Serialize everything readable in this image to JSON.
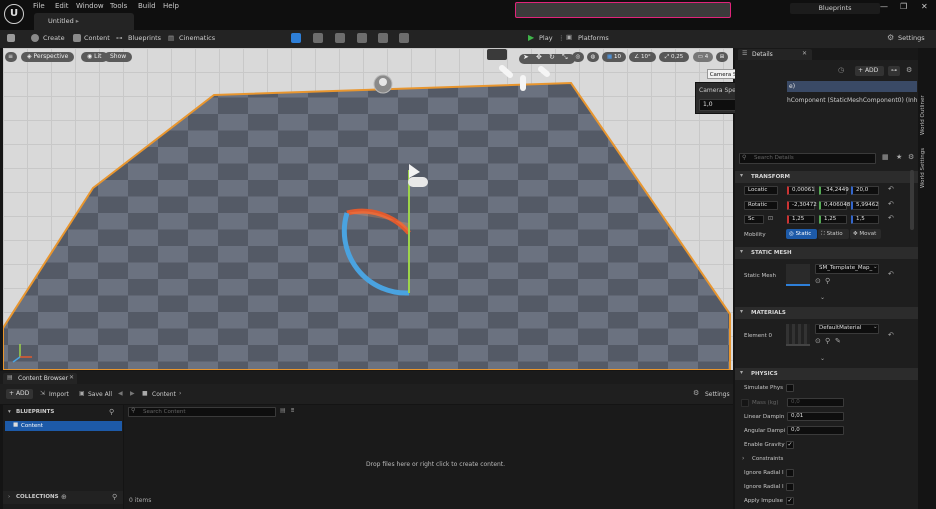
{
  "menu": [
    "File",
    "Edit",
    "Window",
    "Tools",
    "Build",
    "Help"
  ],
  "document_tab": "Untitled",
  "project_name": "Blueprints",
  "window_controls": {
    "minimize": "—",
    "maximize": "❐",
    "close": "✕"
  },
  "toolbar": {
    "create": "Create",
    "content": "Content",
    "blueprints": "Blueprints",
    "cinematics": "Cinematics",
    "play": "Play",
    "platforms": "Platforms",
    "settings": "Settings"
  },
  "viewport": {
    "perspective": "Perspective",
    "lit": "Lit",
    "show": "Show",
    "tools": {
      "grid_snap": "10",
      "rotation_snap": "10°",
      "scale_snap": "0,25",
      "camera_speed": "4"
    },
    "tooltip": "Camera Speed",
    "camera_speed_popup": {
      "label": "Camera Speed Scalar",
      "value": "1,0"
    }
  },
  "content_browser": {
    "tab": "Content Browser",
    "add": "ADD",
    "import": "Import",
    "save_all": "Save All",
    "breadcrumb": "Content",
    "settings": "Settings",
    "blueprints_section": "BLUEPRINTS",
    "tree_item": "Content",
    "search_placeholder": "Search Content",
    "empty_message": "Drop files here or right click to create content.",
    "collections": "COLLECTIONS",
    "item_count": "0 items"
  },
  "details": {
    "tab": "Details",
    "add": "ADD",
    "component_selected": "e)",
    "component_row": "hComponent (StaticMeshComponent0) (Inhe",
    "search_placeholder": "Search Details",
    "transform": {
      "title": "TRANSFORM",
      "location": {
        "label": "Locatic",
        "x": "0,00061",
        "y": "-34,2449",
        "z": "20,0"
      },
      "rotation": {
        "label": "Rotatic",
        "x": "-2,30472",
        "y": "0,406048",
        "z": "5,99462"
      },
      "scale": {
        "label": "Sc",
        "x": "1,25",
        "y": "1,25",
        "z": "1,5"
      },
      "mobility": {
        "label": "Mobility",
        "options": [
          "Static",
          "Statio",
          "Movat"
        ],
        "selected": "Static"
      }
    },
    "static_mesh": {
      "title": "STATIC MESH",
      "label": "Static Mesh",
      "value": "SM_Template_Map_"
    },
    "materials": {
      "title": "MATERIALS",
      "label": "Element 0",
      "value": "DefaultMaterial"
    },
    "physics": {
      "title": "PHYSICS",
      "simulate": "Simulate Phys",
      "mass_label": "Mass (kg)",
      "mass_value": "0,0",
      "linear_label": "Linear Dampin",
      "linear_value": "0,01",
      "angular_label": "Angular Dampi",
      "angular_value": "0,0",
      "gravity": "Enable Gravity",
      "constraints": "Constraints",
      "ignore1": "Ignore Radial I",
      "ignore2": "Ignore Radial I",
      "apply": "Apply Impulse"
    }
  },
  "world_outliner_tab": "World Outliner",
  "world_settings_tab": "World Settings",
  "colors": {
    "accent": "#e0247a",
    "play_green": "#3fb54a",
    "selection_blue": "#1e6fd6",
    "floor_orange": "#e8962f"
  }
}
